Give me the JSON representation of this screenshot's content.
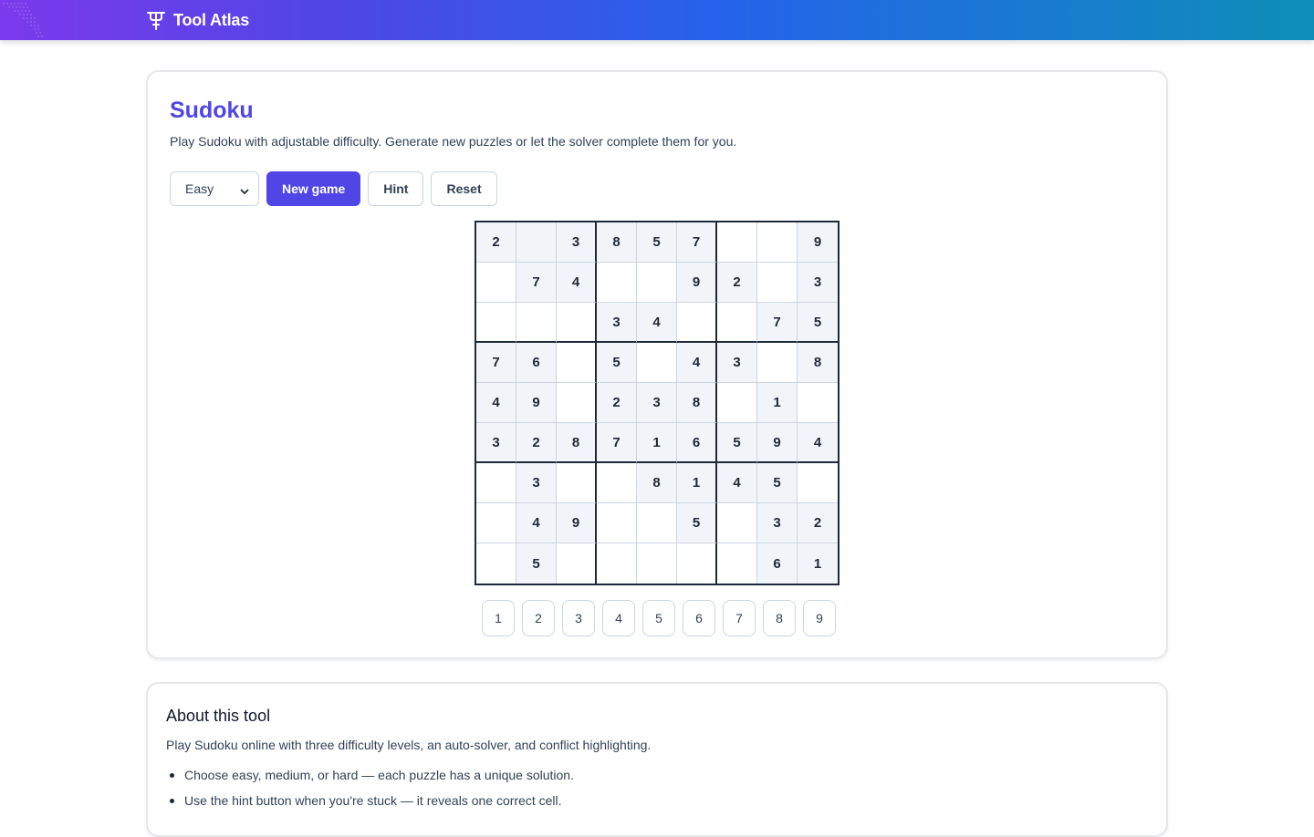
{
  "header": {
    "brand_name": "Tool Atlas",
    "brand_icon": "tool-atlas-logo-icon",
    "gradient_colors": [
      "#7c3aed",
      "#4f46e5",
      "#2563eb",
      "#0e8fb8"
    ]
  },
  "tool": {
    "title": "Sudoku",
    "description": "Play Sudoku with adjustable difficulty. Generate new puzzles or let the solver complete them for you.",
    "difficulty_selected": "Easy",
    "new_game_label": "New game",
    "hint_label": "Hint",
    "reset_label": "Reset",
    "accent_color": "#4f46e5"
  },
  "board": {
    "rows": [
      [
        "2",
        "",
        "3",
        "8",
        "5",
        "7",
        "",
        "",
        "9"
      ],
      [
        "",
        "7",
        "4",
        "",
        "",
        "9",
        "2",
        "",
        "3"
      ],
      [
        "",
        "",
        "",
        "3",
        "4",
        "",
        "",
        "7",
        "5"
      ],
      [
        "7",
        "6",
        "",
        "5",
        "",
        "4",
        "3",
        "",
        "8"
      ],
      [
        "4",
        "9",
        "",
        "2",
        "3",
        "8",
        "",
        "1",
        ""
      ],
      [
        "3",
        "2",
        "8",
        "7",
        "1",
        "6",
        "5",
        "9",
        "4"
      ],
      [
        "",
        "3",
        "",
        "",
        "8",
        "1",
        "4",
        "5",
        ""
      ],
      [
        "",
        "4",
        "9",
        "",
        "",
        "5",
        "",
        "3",
        "2"
      ],
      [
        "",
        "5",
        "",
        "",
        "",
        "",
        "",
        "6",
        "1"
      ]
    ],
    "given": [
      [
        1,
        1,
        1,
        1,
        1,
        1,
        0,
        0,
        1
      ],
      [
        0,
        1,
        1,
        0,
        0,
        1,
        1,
        0,
        1
      ],
      [
        0,
        0,
        0,
        1,
        1,
        0,
        0,
        1,
        1
      ],
      [
        1,
        1,
        0,
        1,
        0,
        1,
        1,
        0,
        1
      ],
      [
        1,
        1,
        0,
        1,
        1,
        1,
        0,
        1,
        0
      ],
      [
        1,
        1,
        1,
        1,
        1,
        1,
        1,
        1,
        1
      ],
      [
        0,
        1,
        0,
        0,
        1,
        1,
        1,
        1,
        0
      ],
      [
        0,
        1,
        1,
        0,
        0,
        1,
        0,
        1,
        1
      ],
      [
        0,
        1,
        0,
        0,
        0,
        0,
        0,
        1,
        1
      ]
    ]
  },
  "numpad": [
    "1",
    "2",
    "3",
    "4",
    "5",
    "6",
    "7",
    "8",
    "9"
  ],
  "about": {
    "title": "About this tool",
    "description": "Play Sudoku online with three difficulty levels, an auto-solver, and conflict highlighting.",
    "items": [
      "Choose easy, medium, or hard — each puzzle has a unique solution.",
      "Use the hint button when you're stuck — it reveals one correct cell."
    ]
  }
}
